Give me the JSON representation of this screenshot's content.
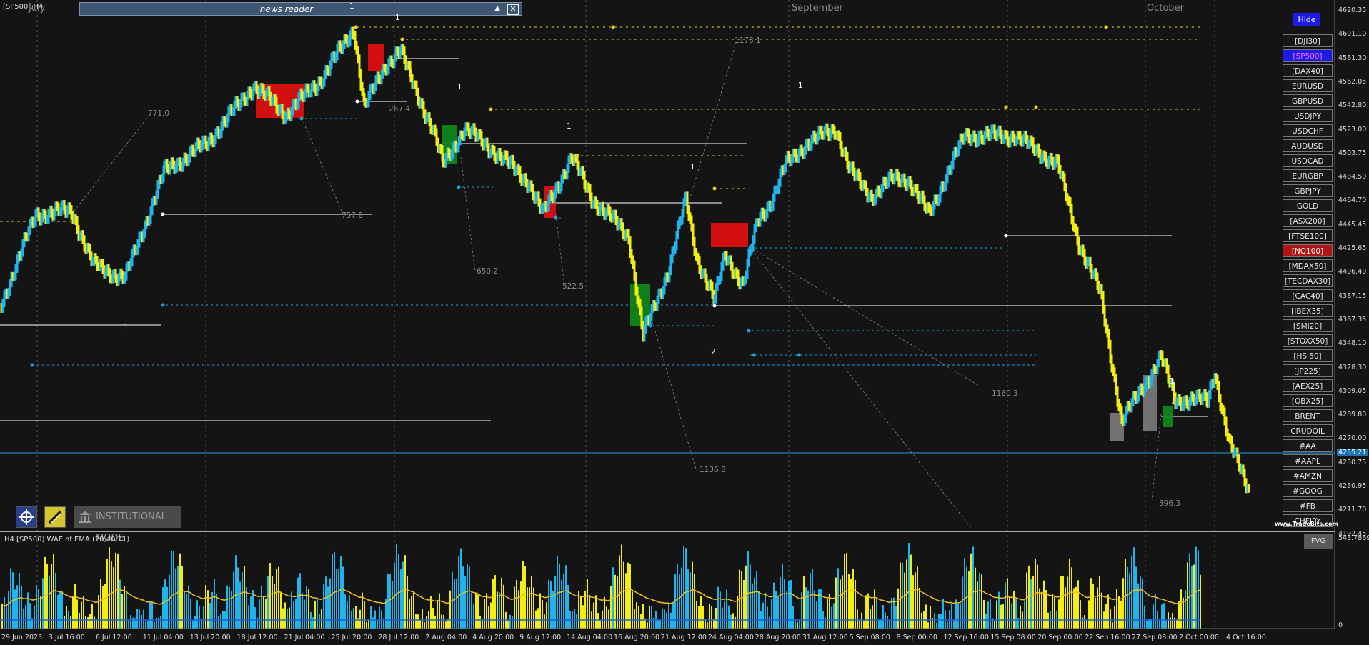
{
  "window": {
    "title": "[SP500],H4"
  },
  "news_reader": {
    "title": "news reader",
    "up_glyph": "▲",
    "close_glyph": "✕"
  },
  "hide_button": "Hide",
  "months": [
    "July",
    "September",
    "October"
  ],
  "symbols": [
    {
      "label": "[DJI30]",
      "state": "normal"
    },
    {
      "label": "[SP500]",
      "state": "active"
    },
    {
      "label": "[DAX40]",
      "state": "normal"
    },
    {
      "label": "EURUSD",
      "state": "normal"
    },
    {
      "label": "GBPUSD",
      "state": "normal"
    },
    {
      "label": "USDJPY",
      "state": "normal"
    },
    {
      "label": "USDCHF",
      "state": "normal"
    },
    {
      "label": "AUDUSD",
      "state": "normal"
    },
    {
      "label": "USDCAD",
      "state": "normal"
    },
    {
      "label": "EURGBP",
      "state": "normal"
    },
    {
      "label": "GBPJPY",
      "state": "normal"
    },
    {
      "label": "GOLD",
      "state": "normal"
    },
    {
      "label": "[ASX200]",
      "state": "normal"
    },
    {
      "label": "[FTSE100]",
      "state": "normal"
    },
    {
      "label": "[NQ100]",
      "state": "alert"
    },
    {
      "label": "[MDAX50]",
      "state": "normal"
    },
    {
      "label": "[TECDAX30]",
      "state": "normal"
    },
    {
      "label": "[CAC40]",
      "state": "normal"
    },
    {
      "label": "[IBEX35]",
      "state": "normal"
    },
    {
      "label": "[SMI20]",
      "state": "normal"
    },
    {
      "label": "[STOXX50]",
      "state": "normal"
    },
    {
      "label": "[HSI50]",
      "state": "normal"
    },
    {
      "label": "[JP225]",
      "state": "normal"
    },
    {
      "label": "[AEX25]",
      "state": "normal"
    },
    {
      "label": "[OBX25]",
      "state": "normal"
    },
    {
      "label": "BRENT",
      "state": "normal"
    },
    {
      "label": "CRUDOIL",
      "state": "normal"
    },
    {
      "label": "#AA",
      "state": "normal"
    },
    {
      "label": "#AAPL",
      "state": "normal"
    },
    {
      "label": "#AMZN",
      "state": "normal"
    },
    {
      "label": "#GOOG",
      "state": "normal"
    },
    {
      "label": "#FB",
      "state": "normal"
    },
    {
      "label": "CHFJPY",
      "state": "normal"
    }
  ],
  "price_axis": [
    "4620.35",
    "4601.10",
    "4581.30",
    "4562.05",
    "4542.80",
    "4523.00",
    "4503.75",
    "4484.50",
    "4464.70",
    "4445.45",
    "4425.65",
    "4406.40",
    "4387.15",
    "4367.35",
    "4348.10",
    "4328.30",
    "4309.05",
    "4289.80",
    "4270.00",
    "4250.75",
    "4230.95",
    "4211.70",
    "4192.45"
  ],
  "current_price": "4255.21",
  "time_axis": [
    "29 Jun 2023",
    "3 Jul 16:00",
    "6 Jul 12:00",
    "11 Jul 04:00",
    "13 Jul 20:00",
    "18 Jul 12:00",
    "21 Jul 04:00",
    "25 Jul 20:00",
    "28 Jul 12:00",
    "2 Aug 04:00",
    "4 Aug 20:00",
    "9 Aug 12:00",
    "14 Aug 04:00",
    "16 Aug 20:00",
    "21 Aug 12:00",
    "24 Aug 04:00",
    "28 Aug 20:00",
    "31 Aug 12:00",
    "5 Sep 08:00",
    "8 Sep 00:00",
    "12 Sep 16:00",
    "15 Sep 08:00",
    "20 Sep 00:00",
    "22 Sep 16:00",
    "27 Sep 08:00",
    "2 Oct 00:00",
    "4 Oct 16:00"
  ],
  "annotations": [
    "771.0",
    "757.8",
    "267.4",
    "650.2",
    "522.5",
    "1136.8",
    "1178.1",
    "1160.3",
    "396.3"
  ],
  "wave_labels": [
    "1",
    "1",
    "1",
    "1",
    "1",
    "1",
    "1",
    "2",
    "1",
    "1"
  ],
  "tools": {
    "institutional_mode": "INSTITUTIONAL MODE"
  },
  "subwindow": {
    "title": "H4 [SP500] WAE of EMA (20,40,21)",
    "max": "543.7869",
    "min": "0",
    "fvg_button": "FVG"
  },
  "watermark": "www.TradeBits.com",
  "colors": {
    "up": "#1fb4ec",
    "down": "#f2ee14",
    "background": "#141414",
    "bull_zone": "#11891d",
    "bear_zone": "#e60e0e",
    "level_line": "#1f9fd8"
  }
}
